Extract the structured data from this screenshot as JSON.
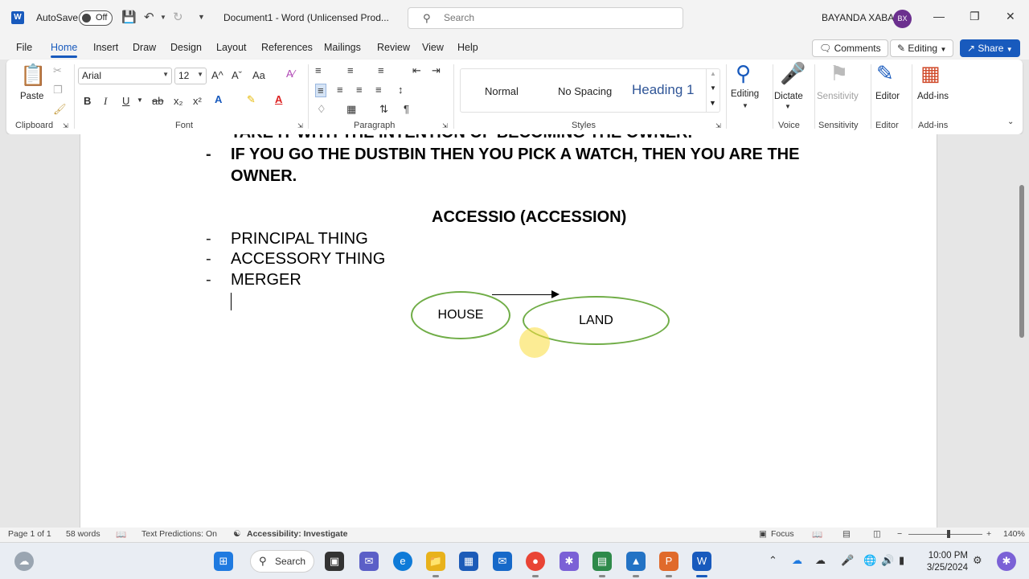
{
  "titlebar": {
    "autosave_label": "AutoSave",
    "autosave_state": "Off",
    "doc_title": "Document1  -  Word (Unlicensed Prod...",
    "search_placeholder": "Search",
    "user_name": "BAYANDA XABA",
    "user_initials": "BX"
  },
  "tabs": [
    "File",
    "Home",
    "Insert",
    "Draw",
    "Design",
    "Layout",
    "References",
    "Mailings",
    "Review",
    "View",
    "Help"
  ],
  "tabs_active": "Home",
  "right_buttons": {
    "comments": "Comments",
    "editing": "Editing",
    "share": "Share"
  },
  "ribbon": {
    "clipboard": {
      "paste": "Paste",
      "label": "Clipboard"
    },
    "font": {
      "name": "Arial",
      "size": "12",
      "label": "Font",
      "bold": "B",
      "italic": "I",
      "underline": "U",
      "strike": "ab",
      "subscript": "x₂",
      "superscript": "x²",
      "grow": "A^",
      "shrink": "Aˇ",
      "case": "Aa"
    },
    "paragraph": {
      "label": "Paragraph"
    },
    "styles": {
      "label": "Styles",
      "normal": "Normal",
      "no_spacing": "No Spacing",
      "heading1": "Heading 1"
    },
    "editing": "Editing",
    "voice": {
      "dictate": "Dictate",
      "label": "Voice"
    },
    "sensitivity": {
      "button": "Sensitivity",
      "label": "Sensitivity"
    },
    "editor": {
      "button": "Editor",
      "label": "Editor"
    },
    "addins": {
      "button": "Add-ins",
      "label": "Add-ins"
    }
  },
  "document": {
    "partial_line": "TAKE IT WITH THE INTENTION OF BECOMING THE OWNER.",
    "bullet_bold_1": "IF YOU GO THE DUSTBIN THEN YOU PICK A WATCH, THEN YOU ARE THE",
    "bullet_bold_2": "OWNER.",
    "heading": "ACCESSIO (ACCESSION)",
    "bullets": [
      "PRINCIPAL THING",
      "ACCESSORY THING",
      "MERGER"
    ],
    "dash": "-",
    "shape_house": "HOUSE",
    "shape_land": "LAND"
  },
  "statusbar": {
    "page": "Page 1 of 1",
    "words": "58 words",
    "text_predictions": "Text Predictions: On",
    "accessibility": "Accessibility: Investigate",
    "focus": "Focus",
    "zoom": "140%"
  },
  "taskbar": {
    "search": "Search",
    "time": "10:00 PM",
    "date": "3/25/2024"
  },
  "colors": {
    "accent": "#185abd",
    "shape_outline": "#70ad47",
    "avatar": "#6b2f8e"
  }
}
